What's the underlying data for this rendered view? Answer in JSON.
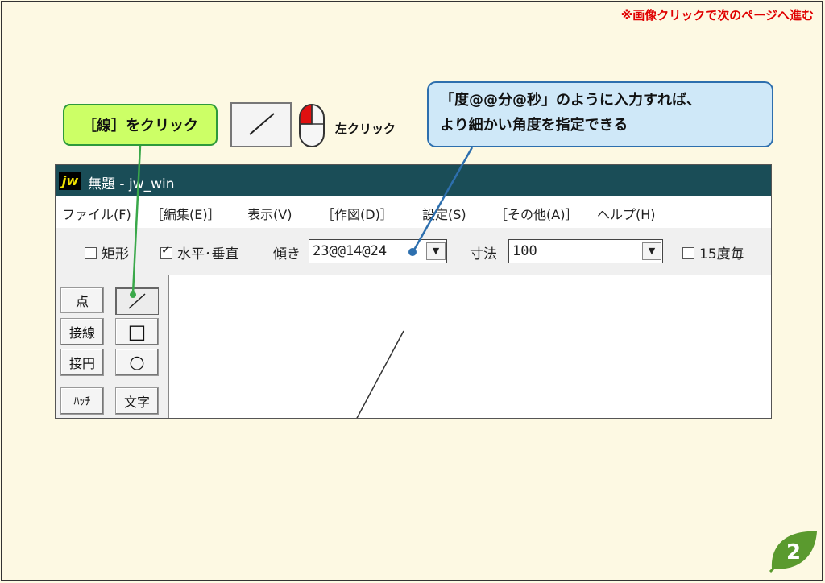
{
  "header_note": "※画像クリックで次のページへ進む",
  "callout_line": "［線］をクリック",
  "callout_angle": {
    "line1": "「度@@分@秒」のように入力すれば、",
    "line2": "より細かい角度を指定できる"
  },
  "left_click_label": "左クリック",
  "window": {
    "logo": "jw",
    "title": "無題 - jw_win",
    "menu": [
      "ファイル(F)",
      "［編集(E)］",
      "表示(V)",
      "［作図(D)］",
      "設定(S)",
      "［その他(A)］",
      "ヘルプ(H)"
    ],
    "toolbar": {
      "rect_label": "矩形",
      "hv_label": "水平･垂直",
      "angle_label": "傾き",
      "angle_value": "23@@14@24",
      "dim_label": "寸法",
      "dim_value": "100",
      "deg15_label": "15度毎"
    },
    "tools_left": [
      "点",
      "接線",
      "接円",
      "ﾊｯﾁ"
    ],
    "tools_right": {
      "rect_symbol": "□",
      "circle_symbol": "○",
      "text": "文字"
    }
  },
  "page_number": "2",
  "colors": {
    "background": "#fdf9e3",
    "header_red": "#e00000",
    "callout_green_fill": "#ccff66",
    "callout_green_border": "#2e9a3c",
    "callout_blue_fill": "#cfe8f8",
    "callout_blue_border": "#2d6fae",
    "titlebar": "#1a4d57",
    "badge_green": "#5a9a2e"
  }
}
